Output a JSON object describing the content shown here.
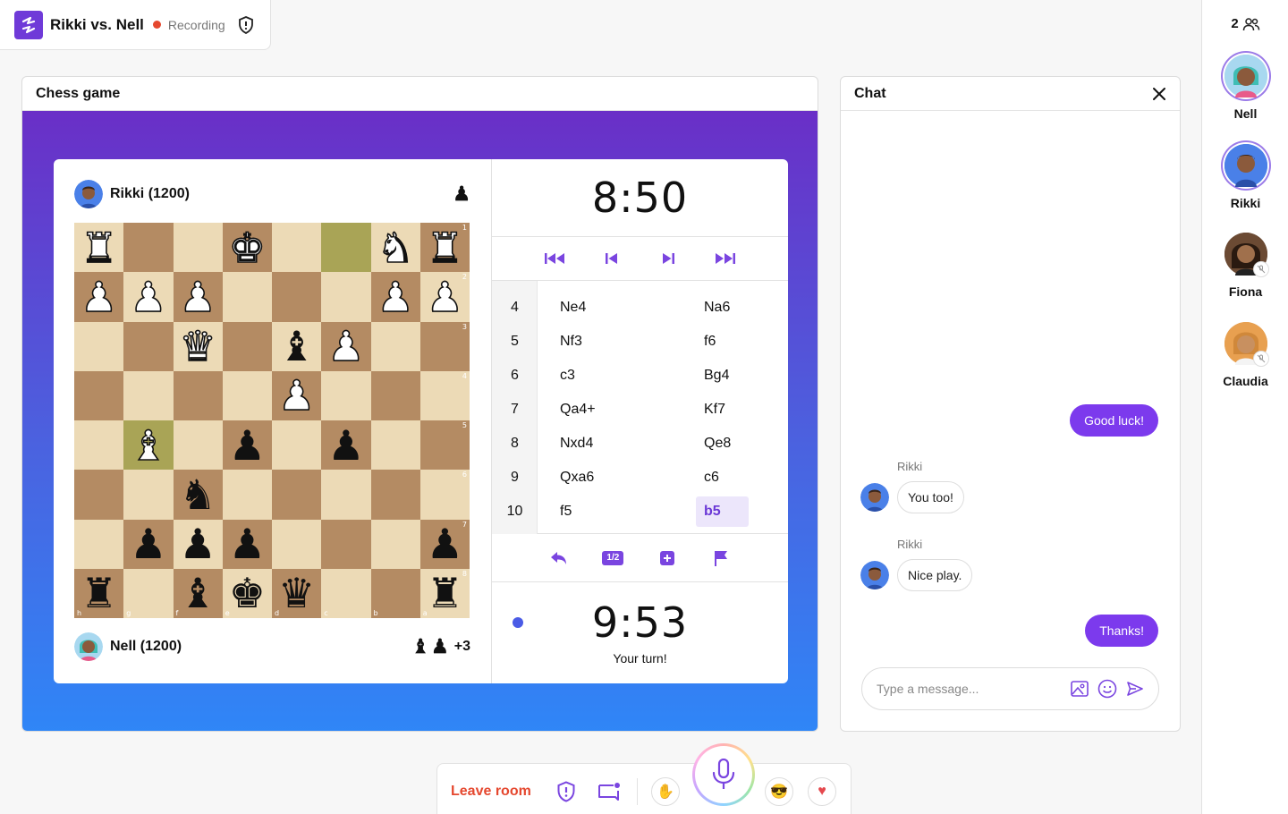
{
  "room": {
    "title": "Rikki vs. Nell",
    "recording_label": "Recording",
    "colors": {
      "brand": "#6f3ad8",
      "recording": "#e5482f"
    }
  },
  "participants": {
    "count": "2",
    "list": [
      {
        "name": "Nell"
      },
      {
        "name": "Rikki"
      },
      {
        "name": "Fiona"
      },
      {
        "name": "Claudia"
      }
    ]
  },
  "chess": {
    "panel_title": "Chess game",
    "top_player": {
      "name": "Rikki (1200)",
      "captured": [
        "♟"
      ]
    },
    "bottom_player": {
      "name": "Nell (1200)",
      "captured": [
        "♝",
        "♟"
      ],
      "advantage": "+3"
    },
    "board": [
      [
        "wR",
        "",
        "",
        "wK",
        "",
        "",
        "wN",
        "wR"
      ],
      [
        "wP",
        "wP",
        "wP",
        "",
        "",
        "",
        "wP",
        "wP"
      ],
      [
        "",
        "",
        "wQ",
        "",
        "bB",
        "wP",
        "",
        ""
      ],
      [
        "",
        "",
        "",
        "",
        "wP",
        "",
        "",
        ""
      ],
      [
        "",
        "wB",
        "",
        "bP",
        "",
        "bP",
        "",
        ""
      ],
      [
        "",
        "",
        "bN",
        "",
        "",
        "",
        "",
        ""
      ],
      [
        "",
        "bP",
        "bP",
        "bP",
        "",
        "",
        "",
        "bP"
      ],
      [
        "bR",
        "",
        "bB",
        "bK",
        "bQ",
        "",
        "",
        "bR"
      ]
    ],
    "ranks": [
      "1",
      "2",
      "3",
      "4",
      "5",
      "6",
      "7",
      "8"
    ],
    "files": [
      "h",
      "g",
      "f",
      "e",
      "d",
      "c",
      "b",
      "a"
    ],
    "highlighted_squares": [
      "0-5",
      "4-1"
    ],
    "top_clock": "8:50",
    "bottom_clock": "9:53",
    "turn_text": "Your turn!",
    "draw_label": "1/2",
    "moves": [
      {
        "num": "4",
        "white": "Ne4",
        "black": "Na6"
      },
      {
        "num": "5",
        "white": "Nf3",
        "black": "f6"
      },
      {
        "num": "6",
        "white": "c3",
        "black": "Bg4"
      },
      {
        "num": "7",
        "white": "Qa4+",
        "black": "Kf7"
      },
      {
        "num": "8",
        "white": "Nxd4",
        "black": "Qe8"
      },
      {
        "num": "9",
        "white": "Qxa6",
        "black": "c6"
      },
      {
        "num": "10",
        "white": "f5",
        "black": "b5",
        "active": true
      }
    ]
  },
  "chat": {
    "title": "Chat",
    "messages": [
      {
        "from": "me",
        "text": "Good luck!"
      },
      {
        "from": "Rikki",
        "sender": "Rikki",
        "text": "You too!"
      },
      {
        "from": "Rikki",
        "sender": "Rikki",
        "text": "Nice play."
      },
      {
        "from": "me",
        "text": "Thanks!"
      }
    ],
    "input_placeholder": "Type a message..."
  },
  "toolbar": {
    "leave_label": "Leave room"
  }
}
